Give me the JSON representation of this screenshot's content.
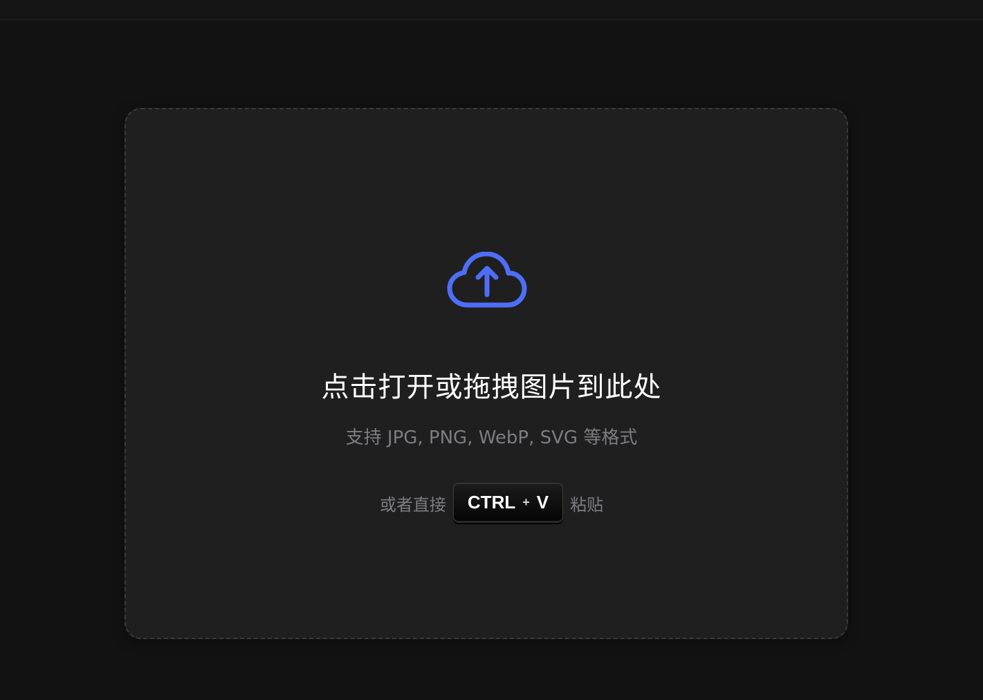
{
  "dropzone": {
    "title": "点击打开或拖拽图片到此处",
    "formats": "支持 JPG, PNG, WebP, SVG 等格式",
    "paste_prefix": "或者直接",
    "shortcut_key1": "CTRL",
    "shortcut_plus": "+",
    "shortcut_key2": "V",
    "paste_suffix": "粘贴",
    "icon": "cloud-upload-icon",
    "accent_color": "#4f6ef7"
  }
}
